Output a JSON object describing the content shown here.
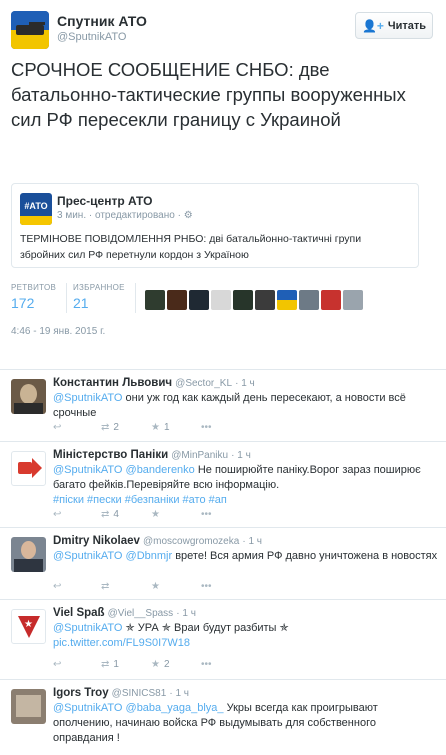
{
  "header": {
    "name": "Спутник АТО",
    "handle": "@SputnikATO",
    "follow_label": "Читать"
  },
  "tweet": {
    "text": "СРОЧНОЕ СООБЩЕНИЕ СНБО: две батальонно-тактические группы вооруженных сил РФ пересекли границу с Украиной",
    "quote": {
      "avatar_label": "#АТО",
      "name": "Прес-центр АТО",
      "meta": "3 мин. · отредактировано · ",
      "text": "ТЕРМІНОВЕ ПОВІДОМЛЕННЯ РНБО: дві батальйонно-тактичні групи збройних сил РФ перетнули кордон з Україною"
    },
    "stats": {
      "retweets_label": "РЕТВИТОВ",
      "retweets": "172",
      "favorites_label": "ИЗБРАННОЕ",
      "favorites": "21"
    },
    "timestamp": "4:46 - 19 янв. 2015 г."
  },
  "replies": [
    {
      "name": "Константин Львович",
      "handle": "@Sector_KL",
      "time": "· 1 ч",
      "mention": "@SputnikATO",
      "text": " они уж год как каждый день пересекают, а новости всё срочные",
      "retweets": "2",
      "favorites": "1"
    },
    {
      "name": "Міністерство Паніки",
      "handle": "@MinPaniku",
      "time": "· 1 ч",
      "mention": "@SputnikATO",
      "mention2": " @banderenko",
      "text": " Не поширюйте паніку.Ворог зараз поширює багато фейків.Перевіряйте всю інформацію.",
      "tags": "#піски #пески  #безпаніки #ато #ап",
      "retweets": "4",
      "favorites": ""
    },
    {
      "name": "Dmitry Nikolaev",
      "handle": "@moscowgromozeka",
      "time": "· 1 ч",
      "mention": "@SputnikATO",
      "mention2": " @Dbnmjr",
      "text": " врете! Вся армия РФ давно уничтожена в новостях",
      "retweets": "",
      "favorites": ""
    },
    {
      "name": "Viel Spaß",
      "handle": "@Viel__Spass",
      "time": "· 1 ч",
      "mention": "@SputnikATO",
      "text": " ✯ УРА ✯ Враи будут разбиты ✯",
      "link": "pic.twitter.com/FL9S0I7W18",
      "retweets": "1",
      "favorites": "2"
    },
    {
      "name": "Igors Troy",
      "handle": "@SINICS81",
      "time": "· 1 ч",
      "mention": "@SputnikATO",
      "mention2": " @baba_yaga_blya_",
      "text": " Укры всегда как проигрывают ополчению, начинаю войска РФ выдумывать для собственного оправдания !",
      "retweets": "",
      "favorites": ""
    }
  ],
  "colors": {
    "link": "#55acee",
    "muted": "#8899a6",
    "text": "#292f33",
    "border": "#e1e8ed"
  }
}
